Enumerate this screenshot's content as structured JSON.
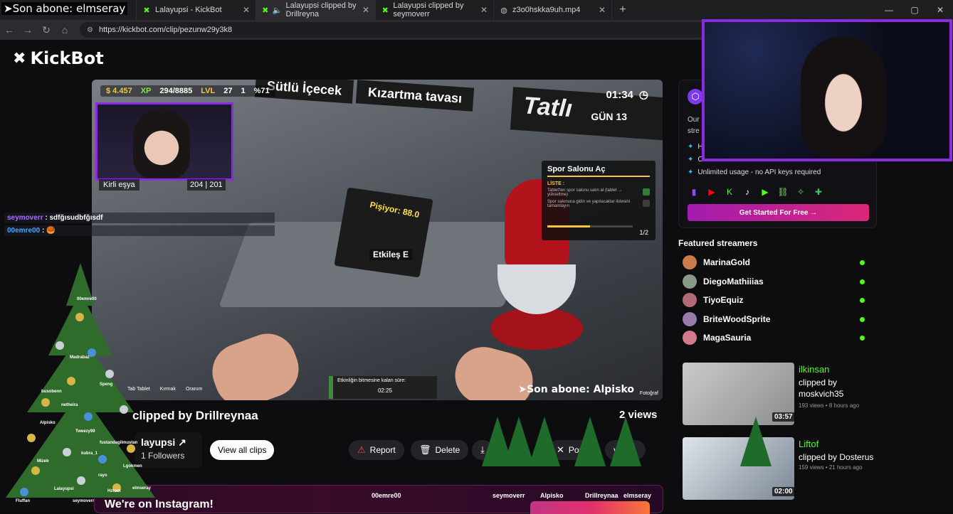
{
  "browser": {
    "tabs": [
      {
        "label": "Lalayupsi - KickBot",
        "active": false
      },
      {
        "label": "Lalayupsi clipped by Drillreyna",
        "active": true
      },
      {
        "label": "Lalayupsi clipped by seymoverr",
        "active": false
      },
      {
        "label": "z3o0hskka9uh.mp4",
        "active": false
      }
    ],
    "url": "https://kickbot.com/clip/pezunw29y3k8",
    "new_tab": "+",
    "win": {
      "min": "—",
      "max": "▢",
      "close": "✕"
    }
  },
  "site": {
    "logo_mark": "✖",
    "logo": "KickBot"
  },
  "video": {
    "hud": {
      "money": "$ 4.457",
      "xp_label": "XP",
      "xp": "294/8885",
      "lvl_label": "LVL",
      "lvl": "27",
      "bulbs": "1",
      "pct": "%71"
    },
    "signs": [
      "Sütlü İçecek",
      "Kızartma tavası",
      "Tatlı"
    ],
    "time": "01:34",
    "day": "GÜN 13",
    "item": "Kirli eşya",
    "item_count": "204 | 201",
    "fryer_label": "Pişiyor: 88.0",
    "interact_label": "Etkileş  E",
    "task": {
      "title": "Spor Salonu Aç",
      "list": "LİSTE :",
      "items": [
        "Tablet'ten spor salonu satın al (tablet → yükseltme)",
        "Spor salonuna gidin ve yapılacaklar listesini tamamlayın"
      ],
      "count": "1/2"
    },
    "event": {
      "label": "Etkinliğin bitmesine kalan süre:",
      "time": "02:25"
    },
    "hints": [
      "Tab  Tablet",
      "Kırmak",
      "Oranım"
    ],
    "last_sub": "➤Son abone: Alpisko",
    "photo": "Fotoğraf"
  },
  "clip": {
    "title": "clipped by Drillreynaa",
    "views": "2 views",
    "streamer": "layupsi",
    "followers": "1 Followers",
    "view_all": "View all clips",
    "report": "Report",
    "delete": "Delete",
    "post": "Pos",
    "copy": "y URL"
  },
  "promo": {
    "text": "Our stre",
    "features": [
      "H",
      "C",
      "Unlimited usage - no API keys required"
    ],
    "cta": "Get Started For Free →"
  },
  "featured": {
    "title": "Featured streamers",
    "streamers": [
      "MarinaGold",
      "DiegoMathiiias",
      "TiyoEquiz",
      "BriteWoodSprite",
      "MagaSauria"
    ]
  },
  "clips": [
    {
      "streamer": "ilkinsan",
      "by": "clipped by moskvich35",
      "meta": "193 views • 8 hours ago",
      "dur": "03:57"
    },
    {
      "streamer": "Liftof",
      "by": "clipped by Dosterus",
      "meta": "159 views • 21 hours ago",
      "dur": "02:00"
    }
  ],
  "instagram": {
    "text": "We're on Instagram!"
  },
  "overlay": {
    "last_sub": "➤Son abone: elmseray",
    "chat": [
      {
        "user": "seymoverr",
        "msg": ": sdfğısudbfğısdf"
      },
      {
        "user": "00emre00",
        "msg": ": 🥮"
      }
    ],
    "tree_names": [
      "00emre00",
      "Lalayupsi",
      "Madrabaz",
      "Speng",
      "busobenn",
      "netheira",
      "Alpisko",
      "Tweezy99",
      "Mizeb",
      "kubra_1",
      "fustandagilmustan",
      "rayo",
      "Hztoot",
      "Lgokmen",
      "elmseray",
      "seymoverr",
      "Fluffan"
    ],
    "bottom_names": [
      "00emre00",
      "seymoverr",
      "Alpisko",
      "Drillreynaa",
      "elmseray"
    ]
  }
}
